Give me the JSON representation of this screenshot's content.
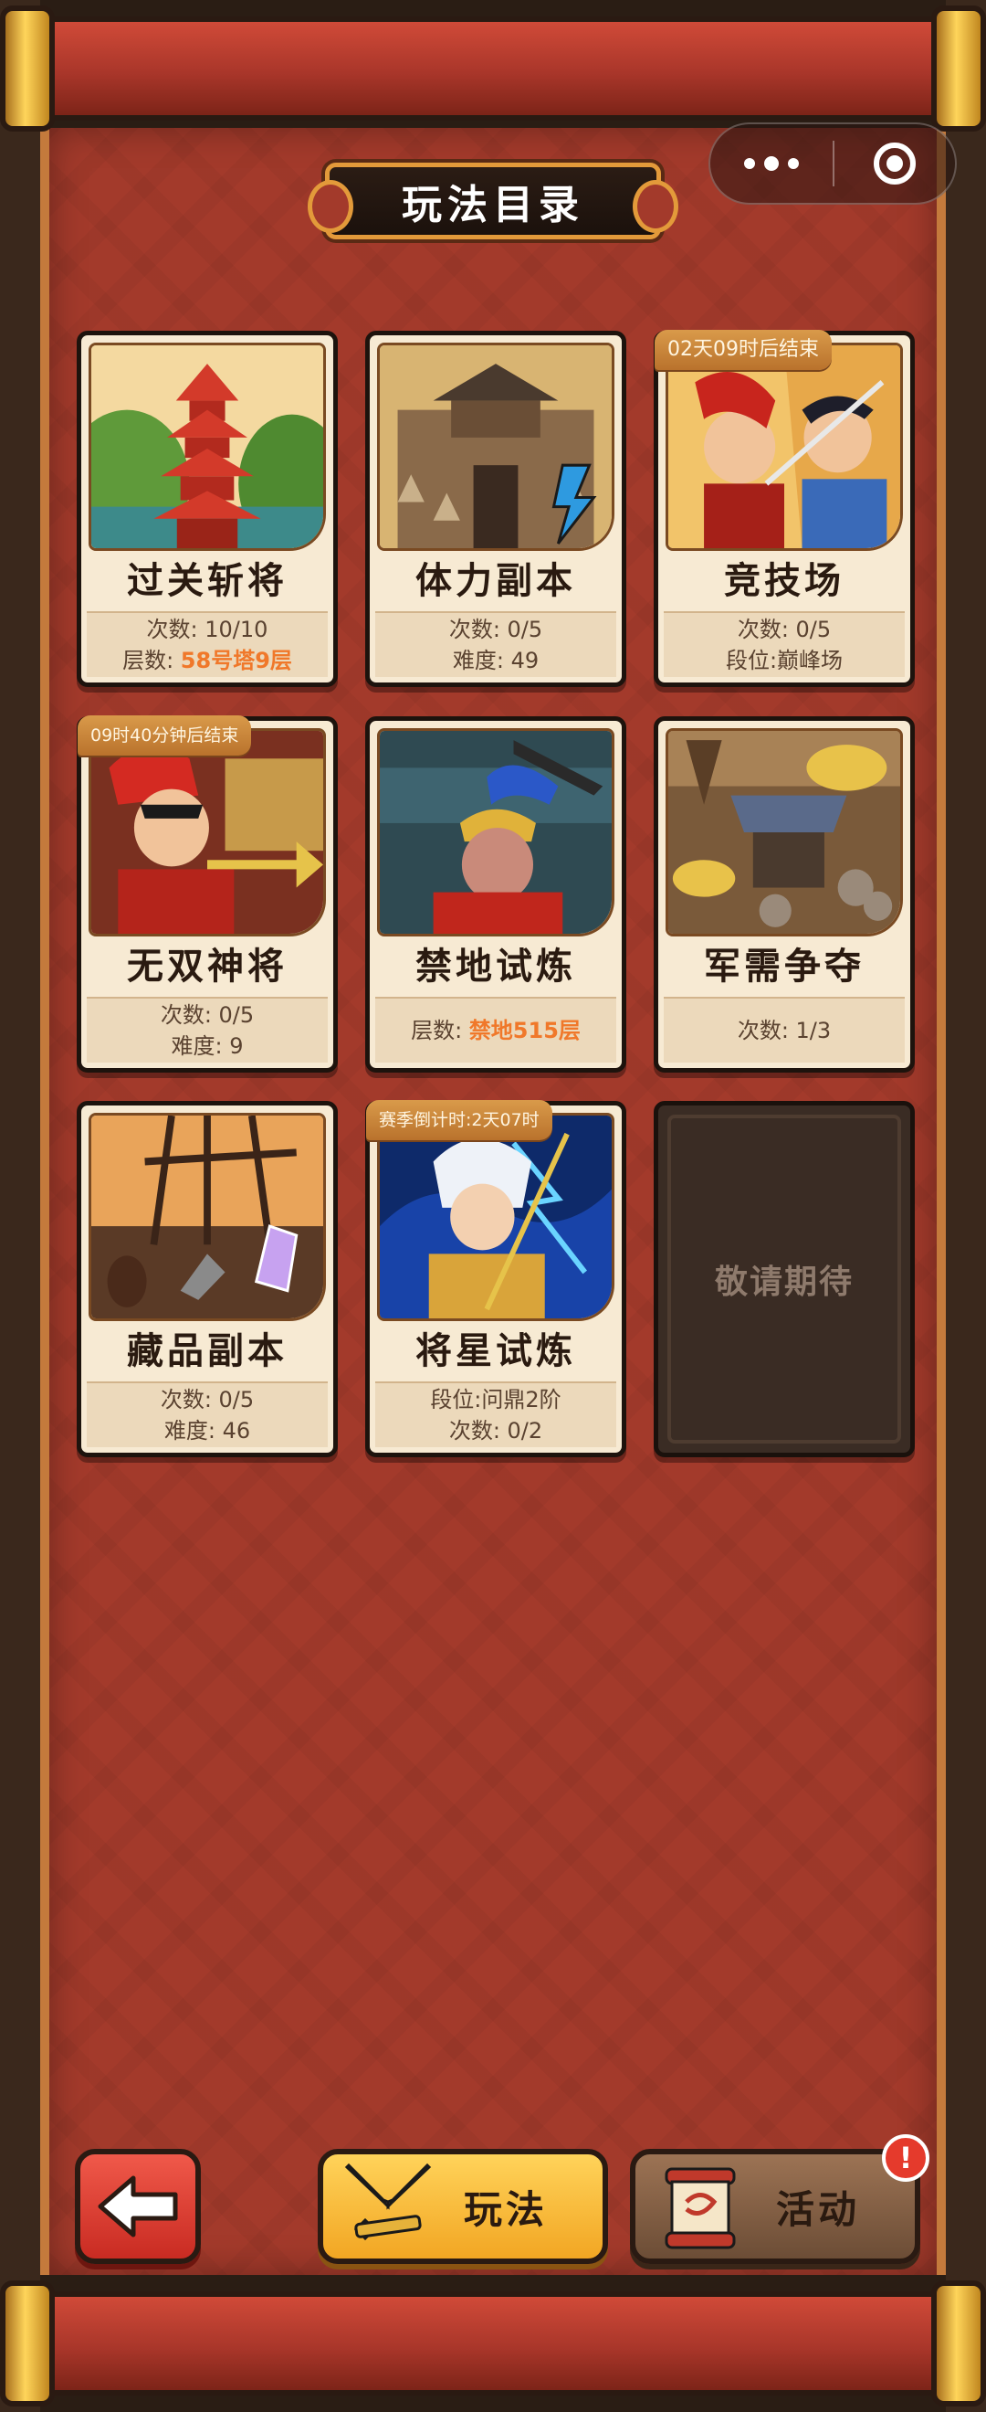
{
  "header": {
    "title": "玩法目录"
  },
  "capsule": {
    "more_label": "更多",
    "close_label": "关闭"
  },
  "cards": [
    {
      "name": "过关斩将",
      "line1": "次数: 10/10",
      "line2_prefix": "层数: ",
      "line2_value": "58号塔9层",
      "badge": ""
    },
    {
      "name": "体力副本",
      "line1": "次数: 0/5",
      "line2_prefix": "难度: 49",
      "line2_value": "",
      "badge": ""
    },
    {
      "name": "竞技场",
      "line1": "次数: 0/5",
      "line2_prefix": "段位:巅峰场",
      "line2_value": "",
      "badge": "02天09时后结束"
    },
    {
      "name": "无双神将",
      "line1": "次数: 0/5",
      "line2_prefix": "难度: 9",
      "line2_value": "",
      "badge": "09时40分钟后结束"
    },
    {
      "name": "禁地试炼",
      "line1": "",
      "line2_prefix": "层数: ",
      "line2_value": "禁地515层",
      "badge": ""
    },
    {
      "name": "军需争夺",
      "line1": "次数: 1/3",
      "line2_prefix": "",
      "line2_value": "",
      "badge": ""
    },
    {
      "name": "藏品副本",
      "line1": "次数: 0/5",
      "line2_prefix": "难度: 46",
      "line2_value": "",
      "badge": ""
    },
    {
      "name": "将星试炼",
      "line1": "段位:问鼎2阶",
      "line2_prefix": "次数: 0/2",
      "line2_value": "",
      "badge": "赛季倒计时:2天07时"
    }
  ],
  "locked_card": {
    "label": "敬请期待"
  },
  "bottom": {
    "play_label": "玩法",
    "event_label": "活动",
    "event_alert": "!"
  },
  "colors": {
    "highlight": "#f0782a",
    "scroll_red": "#a33a2b",
    "gold": "#e39a3a"
  }
}
